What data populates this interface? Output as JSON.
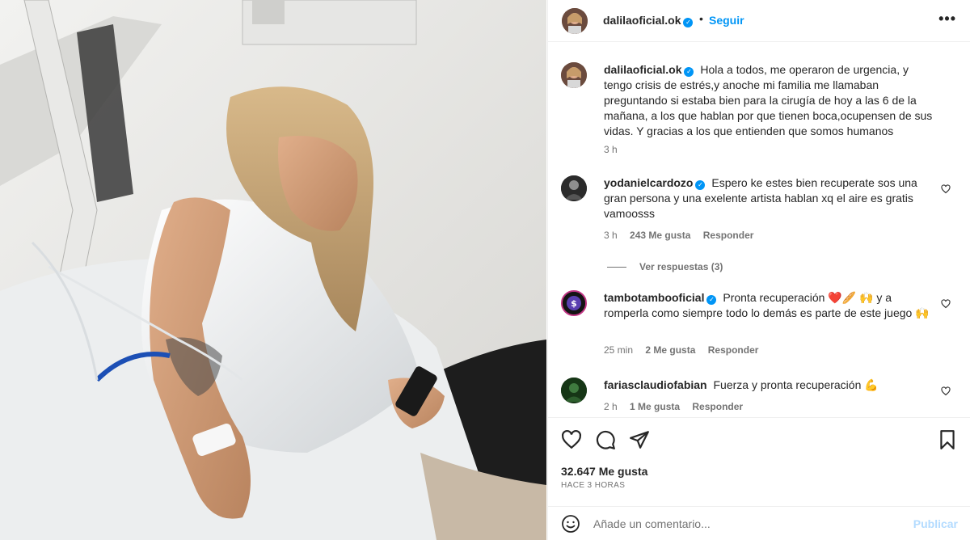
{
  "post": {
    "author": "dalilaoficial.ok",
    "follow_label": "Seguir",
    "separator": "•",
    "more_label": "•••",
    "caption": "Hola a todos, me operaron de urgencia, y tengo crisis de estrés,y anoche mi familia me llamaban preguntando si estaba bien para la cirugía de hoy a las 6 de la mañana, a los que hablan por que tienen boca,ocupensen de sus vidas. Y gracias a los que entienden que somos humanos",
    "caption_time": "3 h",
    "likes": "32.647 Me gusta",
    "posted_ago": "HACE 3 HORAS"
  },
  "comments": [
    {
      "user": "yodanielcardozo",
      "verified": true,
      "text": "Espero ke estes bien recuperate sos una gran persona y una exelente artista hablan xq el aire es gratis vamoosss",
      "time": "3 h",
      "likes": "243 Me gusta",
      "reply_label": "Responder"
    },
    {
      "user": "tambotambooficial",
      "verified": true,
      "text": "Pronta recuperación ❤️🥖 🙌 y a romperla como siempre todo lo demás es parte de este juego 🙌",
      "time": "25 min",
      "likes": "2 Me gusta",
      "reply_label": "Responder"
    },
    {
      "user": "fariasclaudiofabian",
      "verified": false,
      "text": "Fuerza y pronta recuperación 💪",
      "time": "2 h",
      "likes": "1 Me gusta",
      "reply_label": "Responder"
    }
  ],
  "view_replies": "Ver respuestas (3)",
  "composer": {
    "placeholder": "Añade un comentario...",
    "publish_label": "Publicar"
  },
  "icons": {
    "like": "heart-icon",
    "comment": "comment-icon",
    "share": "paper-plane-icon",
    "save": "bookmark-icon",
    "emoji": "smiley-icon",
    "verified": "verified-badge-icon"
  },
  "colors": {
    "accent": "#0095f6",
    "muted": "#737373",
    "publish_disabled": "#b3dbff"
  }
}
